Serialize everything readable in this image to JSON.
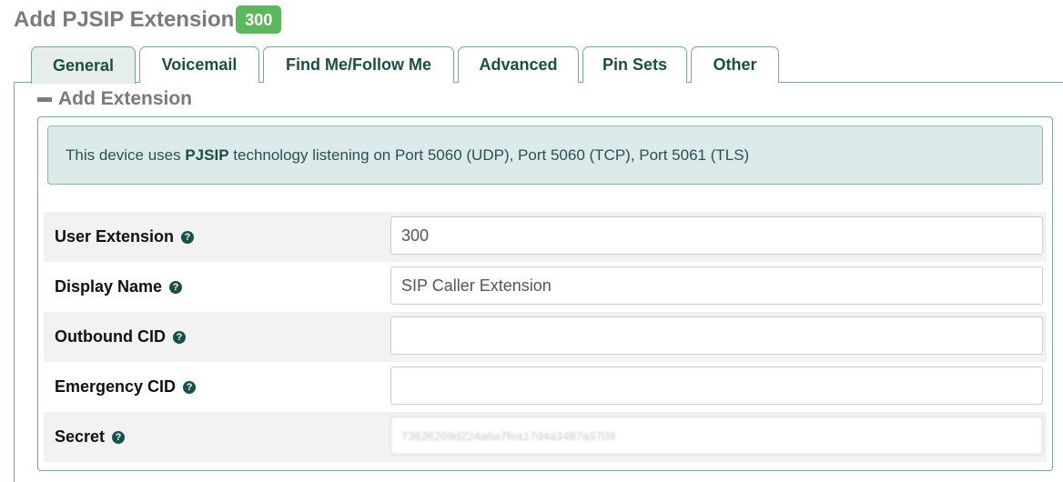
{
  "page": {
    "title": "Add PJSIP Extension",
    "extension_badge": "300"
  },
  "tabs": [
    {
      "label": "General",
      "active": true
    },
    {
      "label": "Voicemail",
      "active": false
    },
    {
      "label": "Find Me/Follow Me",
      "active": false
    },
    {
      "label": "Advanced",
      "active": false
    },
    {
      "label": "Pin Sets",
      "active": false
    },
    {
      "label": "Other",
      "active": false
    }
  ],
  "section": {
    "title": "Add Extension",
    "toggle_icon": "minus-icon"
  },
  "info": {
    "prefix": "This device uses ",
    "tech": "PJSIP",
    "suffix": " technology listening on Port 5060 (UDP), Port 5060 (TCP), Port 5061 (TLS)"
  },
  "fields": {
    "user_extension": {
      "label": "User Extension",
      "value": "300"
    },
    "display_name": {
      "label": "Display Name",
      "value": "SIP Caller Extension"
    },
    "outbound_cid": {
      "label": "Outbound CID",
      "value": ""
    },
    "emergency_cid": {
      "label": "Emergency CID",
      "value": ""
    },
    "secret": {
      "label": "Secret",
      "value": "73626269d224a6a7fea17d4a3487a3709"
    }
  },
  "help_icon": "question-circle-icon",
  "colors": {
    "accent": "#17504a",
    "badge": "#5cb85c",
    "alert_bg": "#dcebea",
    "border": "#78a79b"
  }
}
